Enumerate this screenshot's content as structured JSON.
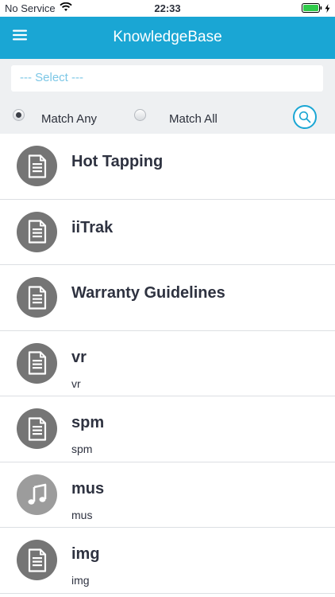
{
  "status_bar": {
    "carrier": "No Service",
    "time": "22:33"
  },
  "header": {
    "title": "KnowledgeBase",
    "menu_icon": "hamburger-menu-icon"
  },
  "filter": {
    "select_placeholder": "--- Select ---",
    "match_any_label": "Match Any",
    "match_all_label": "Match All",
    "selected_mode": "Match Any",
    "search_icon": "search-icon"
  },
  "colors": {
    "accent": "#1aa6d4",
    "icon_dark": "#757575",
    "icon_light": "#9c9c9c"
  },
  "items": [
    {
      "title": "Hot Tapping",
      "subtitle": "",
      "icon": "document-icon"
    },
    {
      "title": "iiTrak",
      "subtitle": "",
      "icon": "document-icon"
    },
    {
      "title": "Warranty Guidelines",
      "subtitle": "",
      "icon": "document-icon"
    },
    {
      "title": "vr",
      "subtitle": "vr",
      "icon": "document-icon"
    },
    {
      "title": "spm",
      "subtitle": "spm",
      "icon": "document-icon"
    },
    {
      "title": "mus",
      "subtitle": "mus",
      "icon": "music-icon"
    },
    {
      "title": "img",
      "subtitle": "img",
      "icon": "document-icon"
    }
  ]
}
